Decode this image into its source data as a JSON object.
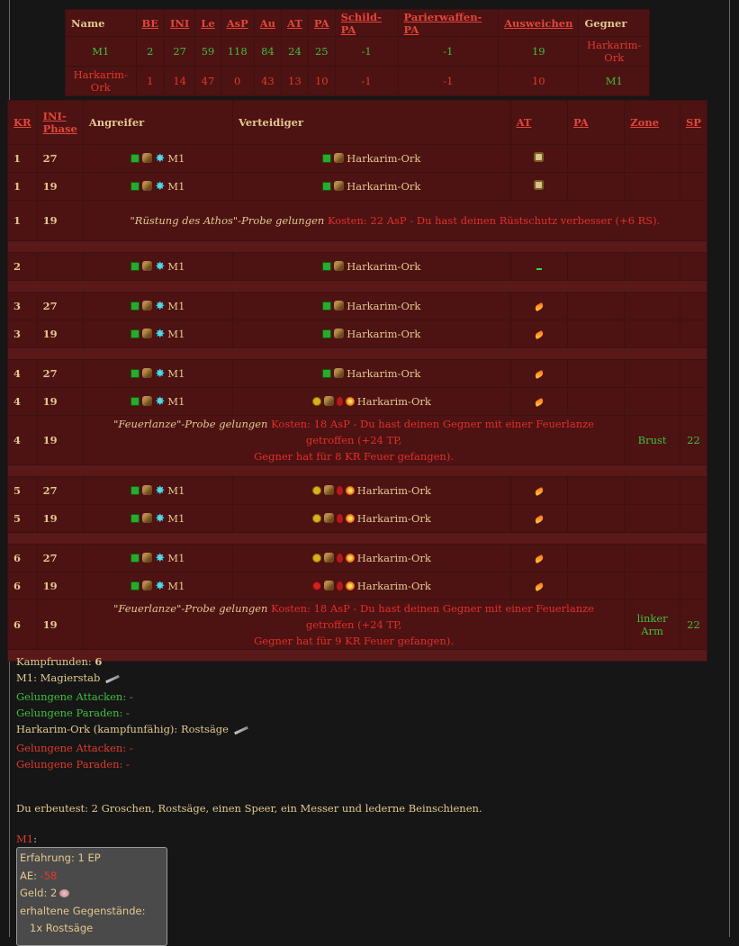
{
  "summary": {
    "headers": [
      "Name",
      "BE",
      "INI",
      "Le",
      "AsP",
      "Au",
      "AT",
      "PA",
      "Schild-PA",
      "Parierwaffen-PA",
      "Ausweichen",
      "Gegner"
    ],
    "rows": [
      {
        "name": "M1",
        "be": "2",
        "ini": "27",
        "le": "59",
        "asp": "118",
        "au": "84",
        "at": "24",
        "pa": "25",
        "schild": "-1",
        "parier": "-1",
        "ausweichen": "19",
        "gegner": "Harkarim-Ork"
      },
      {
        "name": "Harkarim-Ork",
        "be": "1",
        "ini": "14",
        "le": "47",
        "asp": "0",
        "au": "43",
        "at": "13",
        "pa": "10",
        "schild": "-1",
        "parier": "-1",
        "ausweichen": "10",
        "gegner": "M1"
      }
    ]
  },
  "fight": {
    "headers": {
      "kr": "KR",
      "phase_a": "INI-",
      "phase_b": "Phase",
      "attacker": "Angreifer",
      "defender": "Verteidiger",
      "at": "AT",
      "pa": "PA",
      "zone": "Zone",
      "sp": "SP"
    },
    "attacker_name": "M1",
    "defender_name": "Harkarim-Ork",
    "msg1_italic": "\"Rüstung des Athos\"-Probe gelungen",
    "msg1_cost": "Kosten: 22 AsP",
    "msg1_rest": "- Du hast deinen Rüstschutz verbesser (+6 RS).",
    "msg2_italic": "\"Feuerlanze\"-Probe gelungen",
    "msg2_cost": "Kosten: 18 AsP - Du hast deinen Gegner mit einer Feuerlanze getroffen (+24 TP,",
    "msg2_line2": "Gegner hat für 8 KR Feuer gefangen).",
    "msg3_italic": "\"Feuerlanze\"-Probe gelungen",
    "msg3_cost": "Kosten: 18 AsP - Du hast deinen Gegner mit einer Feuerlanze getroffen (+24 TP,",
    "msg3_line2": "Gegner hat für 9 KR Feuer gefangen).",
    "zone_brust": "Brust",
    "zone_arm_a": "linker",
    "zone_arm_b": "Arm",
    "sp_val": "22",
    "rounds": [
      "1",
      "1",
      "1",
      "2",
      "3",
      "3",
      "4",
      "4",
      "4",
      "5",
      "5",
      "6",
      "6",
      "6"
    ],
    "phases": [
      "27",
      "19",
      "19",
      "",
      "27",
      "19",
      "27",
      "19",
      "19",
      "27",
      "19",
      "27",
      "19",
      "19"
    ]
  },
  "footer": {
    "rounds_label": "Kampfrunden:",
    "rounds_value": "6",
    "m1_weapon": "M1: Magierstab",
    "m1_attacks": "Gelungene Attacken: -",
    "m1_parades": "Gelungene Paraden: -",
    "ork_weapon": "Harkarim-Ork (kampfunfähig): Rostsäge",
    "ork_attacks": "Gelungene Attacken: -",
    "ork_parades": "Gelungene Paraden: -",
    "loot": "Du erbeutest: 2 Groschen, Rostsäge, einen Speer, ein Messer und lederne Beinschienen.",
    "m1_label": "M1",
    "m1_colon": ":"
  },
  "loot_box": {
    "xp": "Erfahrung: 1 EP",
    "ae_label": "AE:",
    "ae_value": "-58",
    "gold": "Geld: 2",
    "items_label": "erhaltene Gegenstände:",
    "item1": "1x Rostsäge"
  },
  "colors": {
    "bg": "#161616",
    "table": "#4d1212",
    "gold": "#e2c890",
    "red": "#e03a2c",
    "green": "#3fbf3f"
  }
}
